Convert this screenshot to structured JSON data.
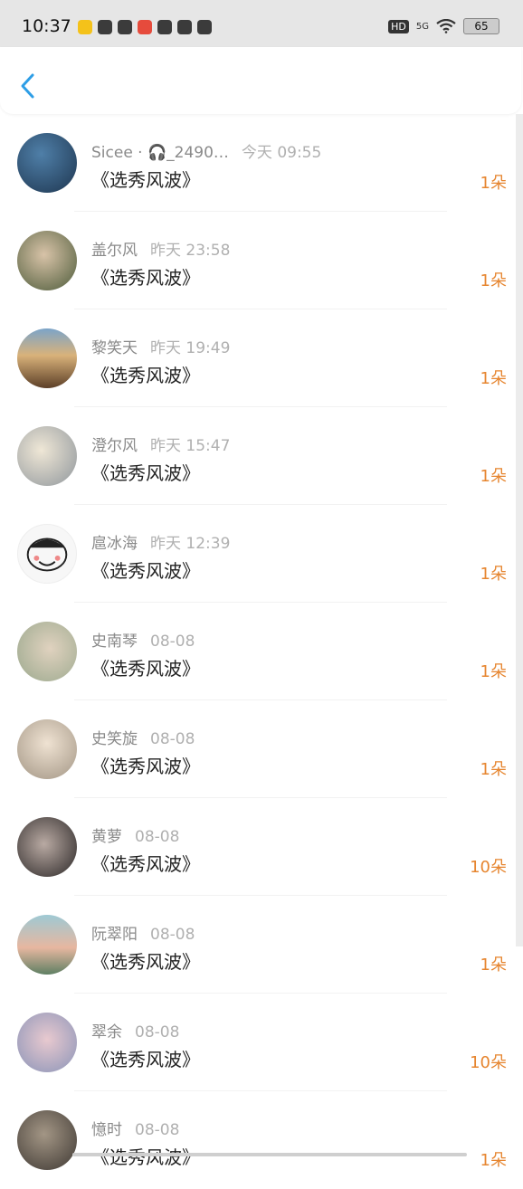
{
  "status": {
    "time": "10:37",
    "battery": "65",
    "network": "5G",
    "hd": "HD"
  },
  "header": {
    "back_icon": "chevron-left-icon",
    "accent": "#2e9ee6"
  },
  "items": [
    {
      "name": "Sicee · 🎧_2490…",
      "time": "今天 09:55",
      "title": "《选秀风波》",
      "count": "1朵",
      "avatar": "#2b4a6b"
    },
    {
      "name": "盖尔风",
      "time": "昨天 23:58",
      "title": "《选秀风波》",
      "count": "1朵",
      "avatar": "#6e7f5a"
    },
    {
      "name": "黎笑天",
      "time": "昨天 19:49",
      "title": "《选秀风波》",
      "count": "1朵",
      "avatar": "#b08a5a"
    },
    {
      "name": "澄尔风",
      "time": "昨天 15:47",
      "title": "《选秀风波》",
      "count": "1朵",
      "avatar": "#a9aeb3"
    },
    {
      "name": "扈冰海",
      "time": "昨天 12:39",
      "title": "《选秀风波》",
      "count": "1朵",
      "avatar": "#f3f3f3"
    },
    {
      "name": "史南琴",
      "time": "08-08",
      "title": "《选秀风波》",
      "count": "1朵",
      "avatar": "#c8b9a2"
    },
    {
      "name": "史笑旋",
      "time": "08-08",
      "title": "《选秀风波》",
      "count": "1朵",
      "avatar": "#cdbba6"
    },
    {
      "name": "黄萝",
      "time": "08-08",
      "title": "《选秀风波》",
      "count": "10朵",
      "avatar": "#3a3535"
    },
    {
      "name": "阮翠阳",
      "time": "08-08",
      "title": "《选秀风波》",
      "count": "1朵",
      "avatar": "#7aa7b3"
    },
    {
      "name": "翠余",
      "time": "08-08",
      "title": "《选秀风波》",
      "count": "10朵",
      "avatar": "#c9a7b6"
    },
    {
      "name": "憶时",
      "time": "08-08",
      "title": "《选秀风波》",
      "count": "1朵",
      "avatar": "#6b625b"
    }
  ]
}
